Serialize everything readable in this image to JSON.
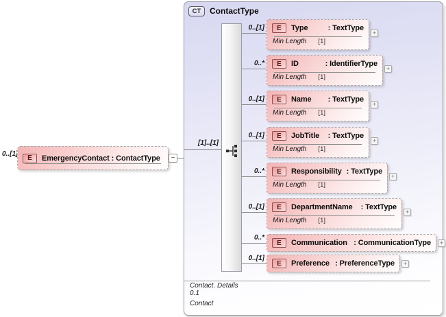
{
  "root": {
    "cardinality": "0..[1]",
    "icon": "E",
    "label": "EmergencyContact : ContactType",
    "collapse_glyph": "−"
  },
  "container": {
    "badge": "CT",
    "title": "ContactType",
    "sequence_cardinality": "[1]..[1]",
    "footer": {
      "line1": "Contact. Details",
      "line2": "0.1",
      "line3": "Contact"
    }
  },
  "children": [
    {
      "cardinality": "0..[1]",
      "icon": "E",
      "name": "Type",
      "type": ": TextType",
      "facet_name": "Min Length",
      "facet_value": "[1]",
      "expand_glyph": "+"
    },
    {
      "cardinality": "0..*",
      "icon": "E",
      "name": "ID",
      "type": ": IdentifierType",
      "facet_name": "Min Length",
      "facet_value": "[1]",
      "expand_glyph": "+"
    },
    {
      "cardinality": "0..[1]",
      "icon": "E",
      "name": "Name",
      "type": ": TextType",
      "facet_name": "Min Length",
      "facet_value": "[1]",
      "expand_glyph": "+"
    },
    {
      "cardinality": "0..[1]",
      "icon": "E",
      "name": "JobTitle",
      "type": ": TextType",
      "facet_name": "Min Length",
      "facet_value": "[1]",
      "expand_glyph": "+"
    },
    {
      "cardinality": "0..*",
      "icon": "E",
      "name": "Responsibility",
      "type": ": TextType",
      "facet_name": "Min Length",
      "facet_value": "[1]",
      "expand_glyph": "+"
    },
    {
      "cardinality": "0..[1]",
      "icon": "E",
      "name": "DepartmentName",
      "type": ": TextType",
      "facet_name": "Min Length",
      "facet_value": "[1]",
      "expand_glyph": "+"
    },
    {
      "cardinality": "0..*",
      "icon": "E",
      "name": "Communication",
      "type": ": CommunicationType",
      "facet_name": "",
      "facet_value": "",
      "expand_glyph": "+"
    },
    {
      "cardinality": "0..[1]",
      "icon": "E",
      "name": "Preference",
      "type": ": PreferenceType",
      "facet_name": "",
      "facet_value": "",
      "expand_glyph": "+"
    }
  ],
  "colors": {
    "element_fill": "#f4b4b4",
    "element_icon_border": "#8d4e4e",
    "container_fill": "#d7d7f1",
    "connector": "#8a8a8a"
  }
}
